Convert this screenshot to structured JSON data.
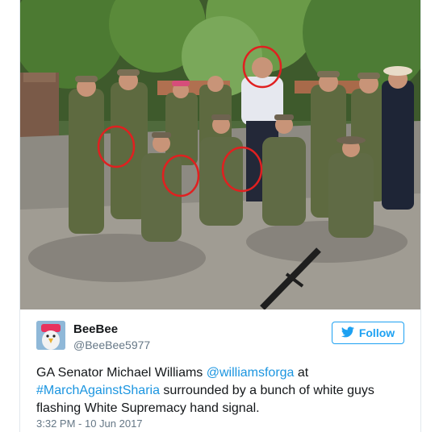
{
  "tweet": {
    "author": {
      "display_name": "BeeBee",
      "handle": "@BeeBee5977"
    },
    "follow_label": "Follow",
    "text_parts": {
      "p1": "GA Senator Michael Williams ",
      "mention": "@williamsforga",
      "p2": " at ",
      "hashtag": "#MarchAgainstSharia",
      "p3": " surrounded by a bunch of white guys flashing White Supremacy hand signal."
    },
    "timestamp": "3:32 PM - 10 Jun 2017"
  },
  "colors": {
    "link": "#1b95e0",
    "follow": "#1da1f2",
    "annotation_circle": "#e02020"
  },
  "icons": {
    "follow": "twitter-bird-icon"
  }
}
